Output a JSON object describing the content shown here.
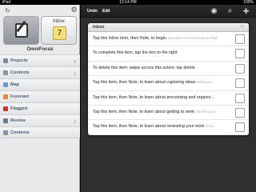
{
  "status_bar": {
    "time": "12:14 PM",
    "wifi": "iPad",
    "battery": "100%"
  },
  "sidebar": {
    "compose_label": "",
    "inbox_label": "Inbox",
    "inbox_count": "7",
    "app_name": "OmniFocus",
    "items": [
      {
        "label": "Projects",
        "icon": "projects-icon",
        "color": "#7a8aa0",
        "chevron": true
      },
      {
        "label": "Contexts",
        "icon": "contexts-icon",
        "color": "#8a94a6",
        "chevron": true
      },
      {
        "label": "Map",
        "icon": "map-icon",
        "color": "#6e9bd1",
        "chevron": false
      },
      {
        "label": "Forecast",
        "icon": "forecast-icon",
        "color": "#d88a3a",
        "chevron": false
      },
      {
        "label": "Flagged",
        "icon": "flag-icon",
        "color": "#c0392b",
        "chevron": false
      },
      {
        "label": "Review",
        "icon": "review-icon",
        "color": "#6b7a8e",
        "chevron": true
      },
      {
        "label": "Contexts",
        "icon": "contexts-icon",
        "color": "#8a94a6",
        "chevron": false
      }
    ]
  },
  "toolbar": {
    "undo_label": "Undo",
    "edit_label": "Edit"
  },
  "inbox_panel": {
    "title": "Inbox",
    "rows": [
      {
        "text": "Tap this Inbox item, then Note, to begin",
        "note": "Welcome to OmniFocus for iPad"
      },
      {
        "text": "To complete this item, tap the box to the right",
        "note": ""
      },
      {
        "text": "To delete this item: swipe across this action; tap delete",
        "note": ""
      },
      {
        "text": "Tap this item, then Note, to learn about capturing ideas",
        "note": "What you ..."
      },
      {
        "text": "Tap this item, then Note, to learn about processing and organiz...",
        "note": ""
      },
      {
        "text": "Tap this item, then Note, to learn about getting to work",
        "note": "OmniFocus f..."
      },
      {
        "text": "Tap this item, then Note, to learn about reviewing your work",
        "note": "Once..."
      }
    ]
  }
}
